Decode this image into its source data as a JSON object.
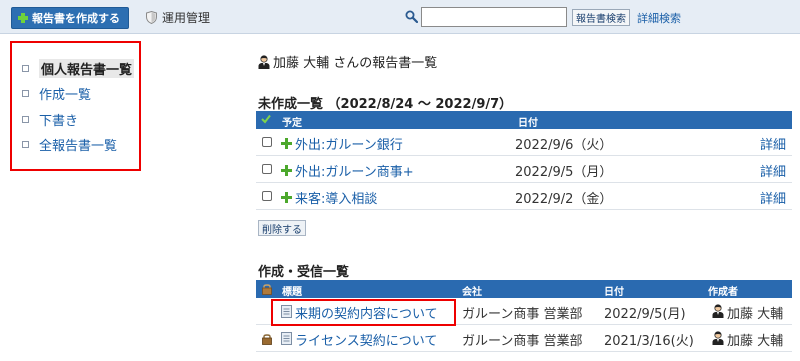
{
  "toolbar": {
    "create_label": "報告書を作成する",
    "admin_label": "運用管理",
    "search_value": "",
    "search_button": "報告書検索",
    "advanced_search": "詳細検索"
  },
  "sidebar": {
    "items": [
      {
        "label": "個人報告書一覧",
        "active": true
      },
      {
        "label": "作成一覧"
      },
      {
        "label": "下書き"
      },
      {
        "label": "全報告書一覧"
      }
    ]
  },
  "page_title": "加藤 大輔 さんの報告書一覧",
  "pending": {
    "title": "未作成一覧 （2022/8/24 ～ 2022/9/7）",
    "headers": {
      "plan": "予定",
      "date": "日付"
    },
    "rows": [
      {
        "title": "外出:ガルーン銀行",
        "date": "2022/9/6（火）",
        "detail": "詳細"
      },
      {
        "title": "外出:ガルーン商事+",
        "date": "2022/9/5（月）",
        "detail": "詳細"
      },
      {
        "title": "来客:導入相談",
        "date": "2022/9/2（金）",
        "detail": "詳細"
      }
    ],
    "delete_label": "削除する"
  },
  "reports": {
    "title": "作成・受信一覧",
    "headers": {
      "title": "標題",
      "company": "会社",
      "date": "日付",
      "author": "作成者"
    },
    "rows": [
      {
        "title": "来期の契約内容について",
        "company": "ガルーン商事 営業部",
        "date": "2022/9/5(月)",
        "author": "加藤 大輔",
        "locked": false
      },
      {
        "title": "ライセンス契約について",
        "company": "ガルーン商事 営業部",
        "date": "2021/3/16(火)",
        "author": "加藤 大輔",
        "locked": true
      }
    ]
  },
  "colors": {
    "header_blue": "#2a6ab0",
    "highlight_red": "#e00000",
    "link_blue": "#1a5fa8"
  }
}
